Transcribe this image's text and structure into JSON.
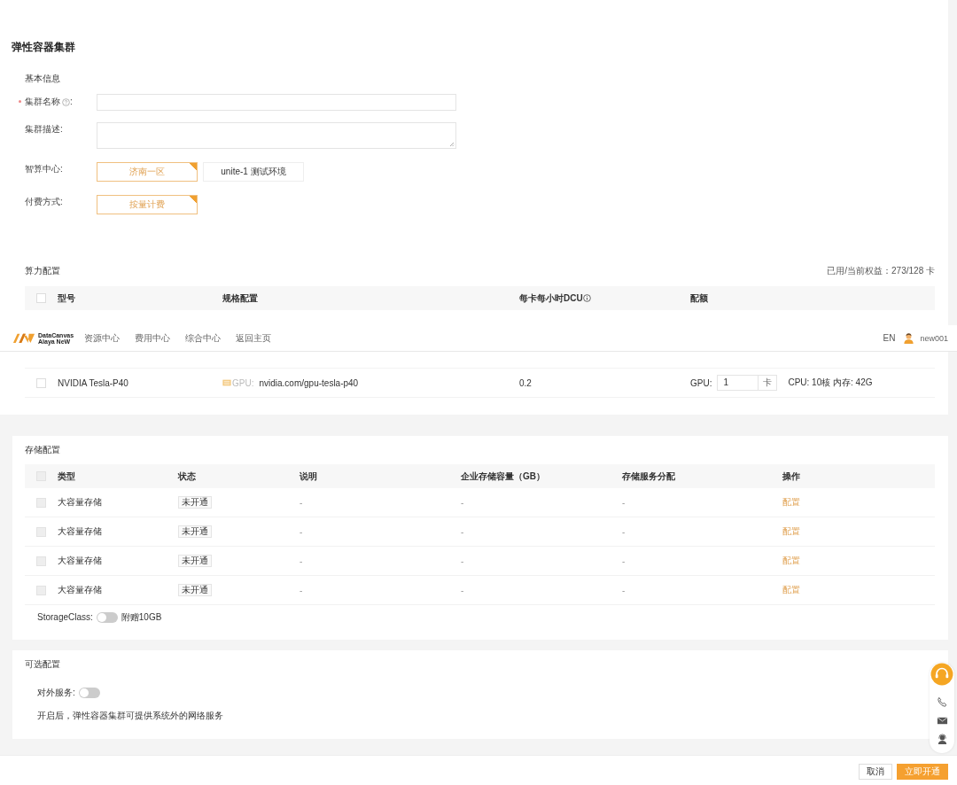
{
  "page_title": "弹性容器集群",
  "basic_info": {
    "heading": "基本信息",
    "fields": [
      {
        "kind": "input",
        "label": "集群名称",
        "required": true,
        "help": true,
        "suffix": ":"
      },
      {
        "kind": "textarea",
        "label": "集群描述:"
      },
      {
        "kind": "options",
        "label": "智算中心:",
        "options": [
          {
            "label": "济南一区",
            "selected": true
          },
          {
            "label": "unite-1 测试环境",
            "selected": false
          }
        ]
      },
      {
        "kind": "options",
        "label": "付费方式:",
        "options": [
          {
            "label": "按量计费",
            "selected": true
          }
        ]
      }
    ]
  },
  "compute": {
    "heading": "算力配置",
    "quota_text": "已用/当前权益：273/128 卡",
    "header_checkbox_disabled": false,
    "columns": [
      {
        "label": "型号",
        "info": false
      },
      {
        "label": "规格配置",
        "info": false
      },
      {
        "label": "每卡每小时DCU",
        "info": true
      },
      {
        "label": "配额",
        "info": false
      }
    ],
    "rows": [
      {
        "checked": false,
        "model": "NVIDIA Tesla-P40",
        "spec_prefix": "GPU:",
        "spec": "nvidia.com/gpu-tesla-p40",
        "dcu": "0.2",
        "quota_label": "GPU:",
        "quota_value": "1",
        "quota_unit": "卡",
        "resources": "CPU: 10核 内存: 42G"
      }
    ]
  },
  "storage": {
    "heading": "存储配置",
    "header_checkbox_disabled": true,
    "columns": [
      "类型",
      "状态",
      "说明",
      "企业存储容量（GB）",
      "存储服务分配",
      "操作"
    ],
    "rows": [
      {
        "disabled": true,
        "type": "大容量存储",
        "status": "未开通",
        "description": "-",
        "capacity": "-",
        "allocation": "-",
        "action": "配置"
      },
      {
        "disabled": true,
        "type": "大容量存储",
        "status": "未开通",
        "description": "-",
        "capacity": "-",
        "allocation": "-",
        "action": "配置"
      },
      {
        "disabled": true,
        "type": "大容量存储",
        "status": "未开通",
        "description": "-",
        "capacity": "-",
        "allocation": "-",
        "action": "配置"
      },
      {
        "disabled": true,
        "type": "大容量存储",
        "status": "未开通",
        "description": "-",
        "capacity": "-",
        "allocation": "-",
        "action": "配置"
      }
    ],
    "storage_class": {
      "label": "StorageClass:",
      "on": false,
      "note": "附赠10GB"
    }
  },
  "optional": {
    "heading": "可选配置",
    "external_service": {
      "label": "对外服务:",
      "on": false
    },
    "description": "开启后，弹性容器集群可提供系统外的网络服务"
  },
  "footer_buttons": [
    {
      "label": "取消",
      "kind": "secondary"
    },
    {
      "label": "立即开通",
      "kind": "primary"
    }
  ],
  "nav": {
    "logo_lines": [
      "DataCanvas",
      "Alaya NeW"
    ],
    "items": [
      "资源中心",
      "费用中心",
      "综合中心",
      "返回主页"
    ],
    "language": "EN",
    "user": "new001"
  }
}
